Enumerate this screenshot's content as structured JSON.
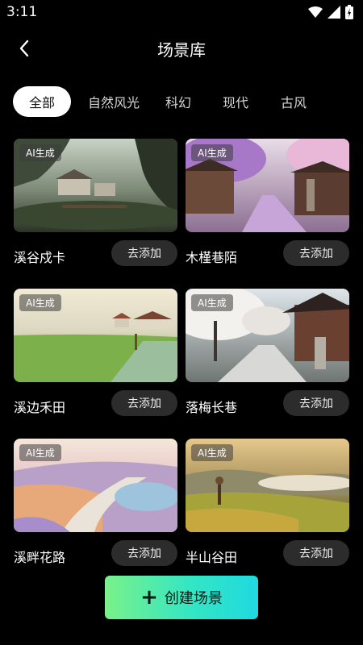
{
  "status": {
    "time": "3:11"
  },
  "header": {
    "title": "场景库"
  },
  "tabs": [
    {
      "label": "全部",
      "active": true
    },
    {
      "label": "自然风光",
      "active": false
    },
    {
      "label": "科幻",
      "active": false
    },
    {
      "label": "现代",
      "active": false
    },
    {
      "label": "古风",
      "active": false
    }
  ],
  "cards": [
    {
      "title": "溪谷戍卡",
      "badge": "AI生成",
      "action": "去添加",
      "scene": "misty-ravine-village"
    },
    {
      "title": "木槿巷陌",
      "badge": "AI生成",
      "action": "去添加",
      "scene": "purple-blossom-lane"
    },
    {
      "title": "溪边禾田",
      "badge": "AI生成",
      "action": "去添加",
      "scene": "misty-rice-field"
    },
    {
      "title": "落梅长巷",
      "badge": "AI生成",
      "action": "去添加",
      "scene": "white-plum-alley"
    },
    {
      "title": "溪畔花路",
      "badge": "AI生成",
      "action": "去添加",
      "scene": "flower-path-pond"
    },
    {
      "title": "半山谷田",
      "badge": "AI生成",
      "action": "去添加",
      "scene": "terraced-valley-sunset"
    }
  ],
  "create_button": {
    "label": "创建场景",
    "icon": "plus-icon"
  }
}
